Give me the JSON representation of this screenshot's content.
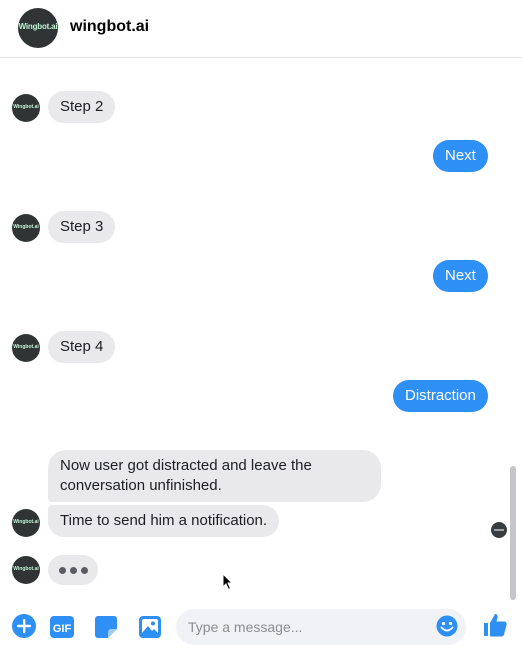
{
  "header": {
    "avatar_text": "Wingbot.ai",
    "title": "wingbot.ai"
  },
  "bot": {
    "avatar_text": "Wingbot.ai"
  },
  "messages": {
    "step2": "Step 2",
    "next1": "Next",
    "step3": "Step 3",
    "next2": "Next",
    "step4": "Step 4",
    "distraction": "Distraction",
    "distracted": "Now user got distracted and leave the conversation unfinished.",
    "notification": "Time to send him a notification."
  },
  "composer": {
    "placeholder": "Type a message...",
    "icons": [
      "add-icon",
      "gif-icon",
      "sticker-icon",
      "photo-icon",
      "emoji-icon",
      "like-icon"
    ],
    "gif_label": "GIF"
  },
  "colors": {
    "accent": "#2e8ff4",
    "incoming_bubble": "#e9e9eb",
    "avatar_bg": "#303434"
  }
}
